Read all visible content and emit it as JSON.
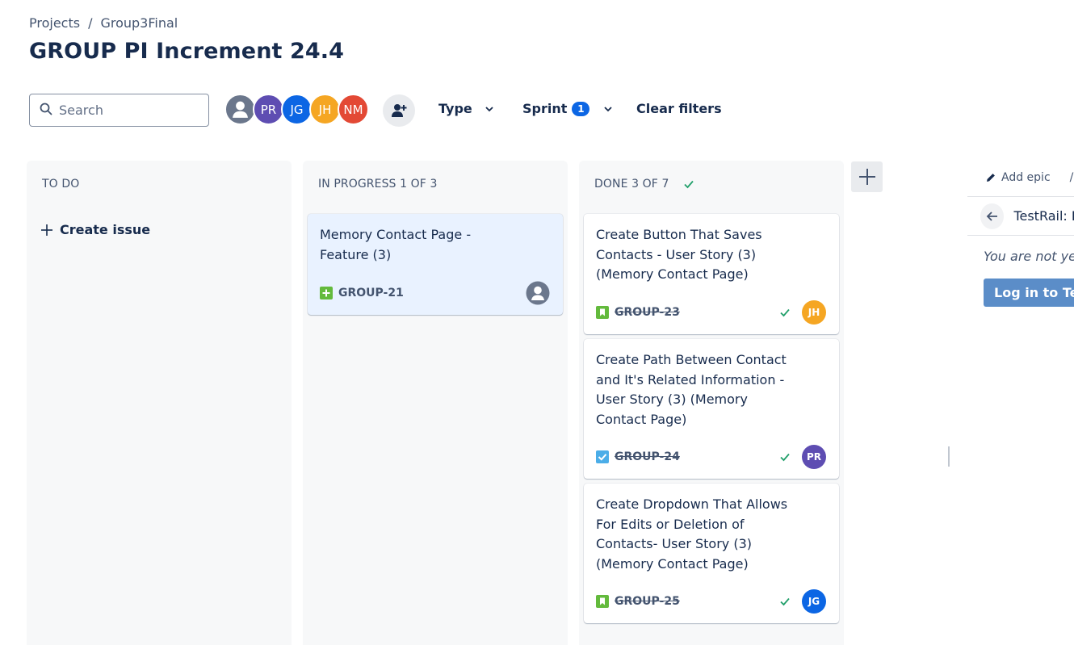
{
  "breadcrumb": {
    "items": [
      "Projects",
      "Group3Final"
    ],
    "separator": "/"
  },
  "page": {
    "title": "GROUP PI Increment 24.4"
  },
  "search": {
    "placeholder": "Search",
    "value": ""
  },
  "avatars": [
    {
      "initials": "",
      "color": "#6b778c",
      "icon": "user-icon"
    },
    {
      "initials": "PR",
      "color": "#5e4db2"
    },
    {
      "initials": "JG",
      "color": "#0c66e4"
    },
    {
      "initials": "JH",
      "color": "#f5a623"
    },
    {
      "initials": "NM",
      "color": "#e34935"
    }
  ],
  "filters": {
    "type_label": "Type",
    "sprint_label": "Sprint",
    "sprint_count": "1",
    "clear_label": "Clear filters"
  },
  "columns": [
    {
      "title": "TO DO",
      "count": "",
      "create_label": "Create issue",
      "cards": []
    },
    {
      "title": "IN PROGRESS",
      "count": "1 OF 3",
      "cards": [
        {
          "title": "Memory Contact Page - Feature (3)",
          "key": "GROUP-21",
          "issue_type": "epic",
          "icon": "feature-plus-icon",
          "assignee": "",
          "done": false
        }
      ]
    },
    {
      "title": "DONE",
      "count": "3 OF 7",
      "cards": [
        {
          "title": "Create Button That Saves Contacts - User Story (3) (Memory Contact Page)",
          "key": "GROUP-23",
          "issue_type": "story",
          "icon": "story-bookmark-icon",
          "assignee": "JH",
          "assignee_color": "#f5a623",
          "done": true
        },
        {
          "title": "Create Path Between Contact and It's Related Information - User Story (3) (Memory Contact Page)",
          "key": "GROUP-24",
          "issue_type": "task",
          "icon": "task-checkbox-icon",
          "assignee": "PR",
          "assignee_color": "#5e4db2",
          "done": true
        },
        {
          "title": "Create Dropdown That Allows For Edits or Deletion of Contacts- User Story (3) (Memory Contact Page)",
          "key": "GROUP-25",
          "issue_type": "story",
          "icon": "story-bookmark-icon",
          "assignee": "JG",
          "assignee_color": "#0c66e4",
          "done": true
        }
      ]
    }
  ],
  "side_panel": {
    "add_epic_label": "Add epic",
    "add_epic_separator": "/",
    "testrail_title": "TestRail: R",
    "message": "You are not yet",
    "login_label": "Log in to Test"
  },
  "colors": {
    "accent": "#0c66e4",
    "done_check": "#22a06b",
    "story": "#63ba3c",
    "task": "#4bade8"
  }
}
